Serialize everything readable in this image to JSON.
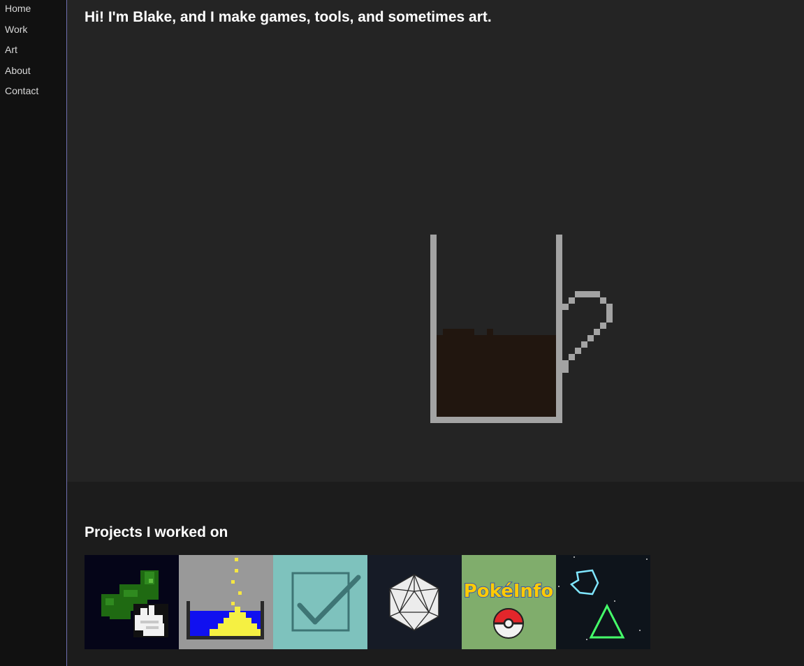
{
  "nav": {
    "items": [
      {
        "label": "Home"
      },
      {
        "label": "Work"
      },
      {
        "label": "Art"
      },
      {
        "label": "About"
      },
      {
        "label": "Contact"
      }
    ]
  },
  "hero": {
    "title": "Hi! I'm Blake, and I make games, tools, and sometimes art."
  },
  "projects": {
    "title": "Projects I worked on",
    "thumbnails": [
      {
        "icon": "pixel-pickle-hand-icon"
      },
      {
        "icon": "falling-sand-icon"
      },
      {
        "icon": "checkmark-icon"
      },
      {
        "icon": "icosahedron-dice-icon"
      },
      {
        "logo_text": "PokéInfo",
        "icon": "pokeball-icon"
      },
      {
        "icon": "neon-shapes-icon"
      }
    ]
  },
  "colors": {
    "sidebar_bg": "#111111",
    "sidebar_border": "#6f6fb0",
    "hero_bg": "#242424",
    "projects_bg": "#1c1c1c",
    "mug_outline": "#a3a3a3",
    "coffee": "#21160f"
  }
}
